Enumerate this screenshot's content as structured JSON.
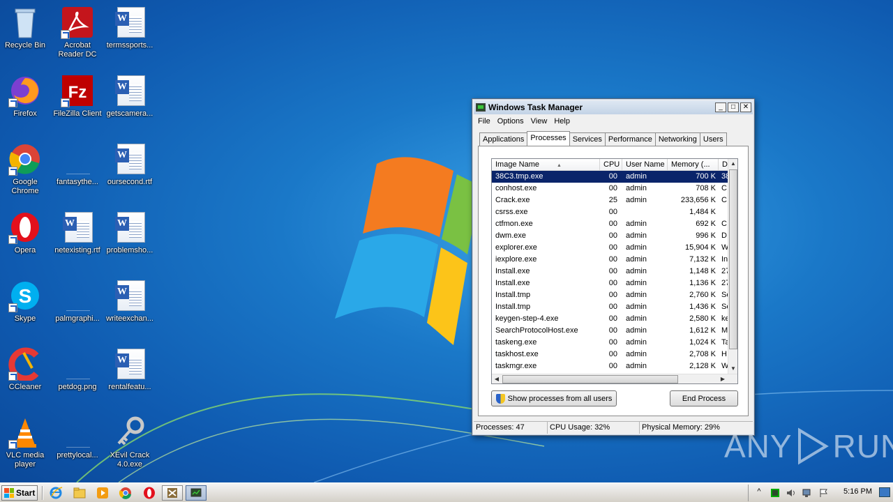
{
  "desktop": {
    "icons": [
      {
        "label": "Recycle Bin",
        "icon": "recycle-bin-icon"
      },
      {
        "label": "Acrobat Reader DC",
        "icon": "acrobat-icon"
      },
      {
        "label": "termssports...",
        "icon": "word-doc-icon"
      },
      {
        "label": "Firefox",
        "icon": "firefox-icon"
      },
      {
        "label": "FileZilla Client",
        "icon": "filezilla-icon"
      },
      {
        "label": "getscamera...",
        "icon": "word-doc-icon"
      },
      {
        "label": "Google Chrome",
        "icon": "chrome-icon"
      },
      {
        "label": "fantasythe...",
        "icon": "blank-file-icon"
      },
      {
        "label": "oursecond.rtf",
        "icon": "word-doc-icon"
      },
      {
        "label": "Opera",
        "icon": "opera-icon"
      },
      {
        "label": "netexisting.rtf",
        "icon": "word-doc-icon"
      },
      {
        "label": "problemsho...",
        "icon": "word-doc-icon"
      },
      {
        "label": "Skype",
        "icon": "skype-icon"
      },
      {
        "label": "palmgraphi...",
        "icon": "blank-file-icon"
      },
      {
        "label": "writeexchan...",
        "icon": "word-doc-icon"
      },
      {
        "label": "CCleaner",
        "icon": "ccleaner-icon"
      },
      {
        "label": "petdog.png",
        "icon": "blank-file-icon"
      },
      {
        "label": "rentalfeatu...",
        "icon": "word-doc-icon"
      },
      {
        "label": "VLC media player",
        "icon": "vlc-icon"
      },
      {
        "label": "prettylocal...",
        "icon": "blank-file-icon"
      },
      {
        "label": "XEvil Crack 4.0.exe",
        "icon": "key-exe-icon"
      }
    ]
  },
  "task_manager": {
    "title": "Windows Task Manager",
    "window_controls": {
      "minimize": "_",
      "maximize": "□",
      "close": "✕"
    },
    "menu": [
      "File",
      "Options",
      "View",
      "Help"
    ],
    "tabs": [
      "Applications",
      "Processes",
      "Services",
      "Performance",
      "Networking",
      "Users"
    ],
    "active_tab": "Processes",
    "columns": [
      "Image Name",
      "CPU",
      "User Name",
      "Memory (...",
      "D"
    ],
    "sort_indicator": "▲",
    "processes": [
      {
        "name": "38C3.tmp.exe",
        "cpu": "00",
        "user": "admin",
        "mem": "700 K",
        "desc": "38",
        "selected": true
      },
      {
        "name": "conhost.exe",
        "cpu": "00",
        "user": "admin",
        "mem": "708 K",
        "desc": "C"
      },
      {
        "name": "Crack.exe",
        "cpu": "25",
        "user": "admin",
        "mem": "233,656 K",
        "desc": "C"
      },
      {
        "name": "csrss.exe",
        "cpu": "00",
        "user": "",
        "mem": "1,484 K",
        "desc": ""
      },
      {
        "name": "ctfmon.exe",
        "cpu": "00",
        "user": "admin",
        "mem": "692 K",
        "desc": "C"
      },
      {
        "name": "dwm.exe",
        "cpu": "00",
        "user": "admin",
        "mem": "996 K",
        "desc": "D"
      },
      {
        "name": "explorer.exe",
        "cpu": "00",
        "user": "admin",
        "mem": "15,904 K",
        "desc": "W"
      },
      {
        "name": "iexplore.exe",
        "cpu": "00",
        "user": "admin",
        "mem": "7,132 K",
        "desc": "In"
      },
      {
        "name": "Install.exe",
        "cpu": "00",
        "user": "admin",
        "mem": "1,148 K",
        "desc": "27"
      },
      {
        "name": "Install.exe",
        "cpu": "00",
        "user": "admin",
        "mem": "1,136 K",
        "desc": "27"
      },
      {
        "name": "Install.tmp",
        "cpu": "00",
        "user": "admin",
        "mem": "2,760 K",
        "desc": "Se"
      },
      {
        "name": "Install.tmp",
        "cpu": "00",
        "user": "admin",
        "mem": "1,436 K",
        "desc": "Se"
      },
      {
        "name": "keygen-step-4.exe",
        "cpu": "00",
        "user": "admin",
        "mem": "2,580 K",
        "desc": "ke"
      },
      {
        "name": "SearchProtocolHost.exe",
        "cpu": "00",
        "user": "admin",
        "mem": "1,612 K",
        "desc": "M"
      },
      {
        "name": "taskeng.exe",
        "cpu": "00",
        "user": "admin",
        "mem": "1,024 K",
        "desc": "Ta"
      },
      {
        "name": "taskhost.exe",
        "cpu": "00",
        "user": "admin",
        "mem": "2,708 K",
        "desc": "H"
      },
      {
        "name": "taskmgr.exe",
        "cpu": "00",
        "user": "admin",
        "mem": "2,128 K",
        "desc": "W"
      }
    ],
    "show_all_button": "Show processes from all users",
    "end_process_button": "End Process",
    "status": {
      "processes": "Processes: 47",
      "cpu": "CPU Usage: 32%",
      "memory": "Physical Memory: 29%"
    }
  },
  "watermark": {
    "left": "ANY",
    "right": "RUN"
  },
  "taskbar": {
    "start_label": "Start",
    "pinned": [
      "ie-icon",
      "explorer-folder-icon",
      "media-player-icon",
      "chrome-icon",
      "opera-icon",
      "crack-app-icon",
      "task-manager-icon"
    ],
    "clock": "5:16 PM",
    "tray_expand": "^"
  },
  "colors": {
    "selection": "#0a246a",
    "desktop": "#1a78c8",
    "taskbar": "#d4d0c8"
  }
}
